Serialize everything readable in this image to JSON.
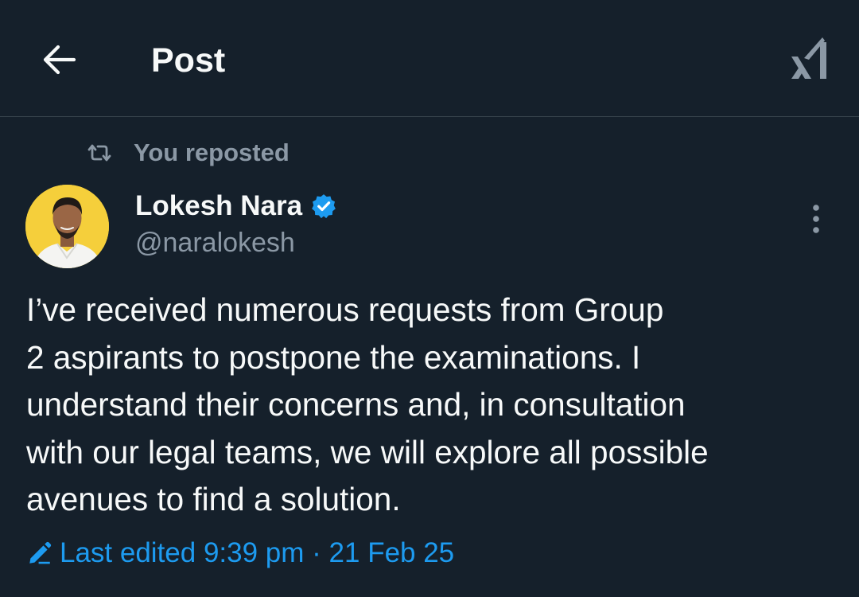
{
  "header": {
    "title": "Post",
    "back_icon": "arrow-left-icon",
    "grok_icon": "grok-icon"
  },
  "social_context": {
    "icon": "repost-icon",
    "text": "You reposted"
  },
  "author": {
    "name": "Lokesh Nara",
    "handle": "@naralokesh",
    "verified": true,
    "verified_color": "#1d9bf0",
    "avatar_bg": "#f5cf3b"
  },
  "post": {
    "text": "I’ve received numerous requests from Group\n2 aspirants to postpone the examinations. I\nunderstand their concerns and, in consultation\nwith our legal teams, we will explore all possible\navenues to find a solution."
  },
  "edited": {
    "icon": "pencil-icon",
    "text": "Last edited 9:39 pm · 21 Feb 25"
  },
  "colors": {
    "background": "#15202b",
    "text": "#f7f9f9",
    "secondary": "#8b98a5",
    "accent": "#1d9bf0",
    "divider": "#38444d"
  }
}
